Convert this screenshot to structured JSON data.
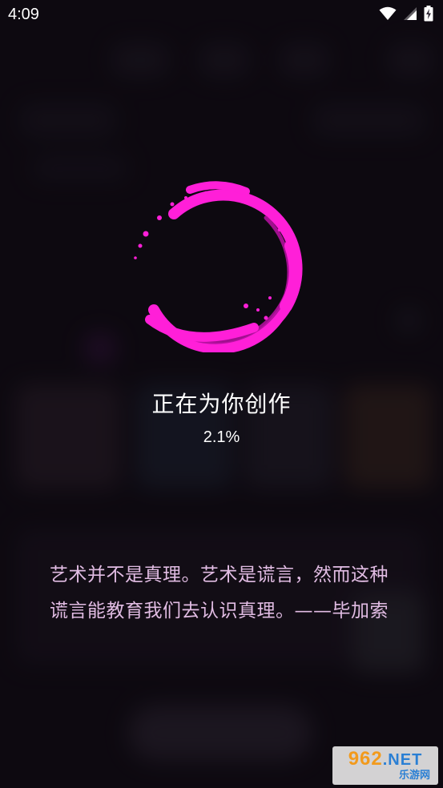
{
  "status_bar": {
    "time": "4:09",
    "icons": [
      "wifi-icon",
      "cell-signal-icon",
      "battery-charging-icon"
    ]
  },
  "loader": {
    "icon": "swirl-loading-ring-icon",
    "title": "正在为你创作",
    "progress_text": "2.1%",
    "progress_value": 0.021,
    "accent_color": "#ff1fd8"
  },
  "quote": {
    "text": "艺术并不是真理。艺术是谎言，然而这种谎言能教育我们去认识真理。——毕加索",
    "color": "#e1bce3"
  },
  "watermark": {
    "number": "962",
    "domain": ".NET",
    "subtitle": "乐游网"
  }
}
